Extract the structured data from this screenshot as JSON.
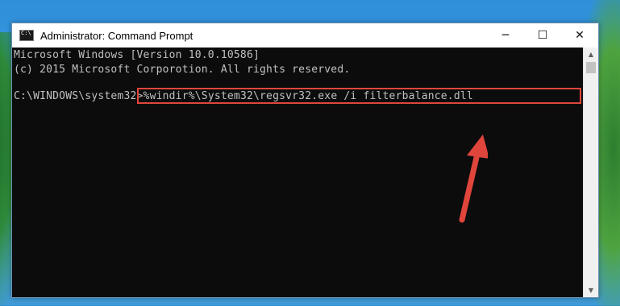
{
  "window": {
    "title": "Administrator: Command Prompt",
    "controls": {
      "minimize": "─",
      "maximize": "☐",
      "close": "✕"
    }
  },
  "console": {
    "lines": [
      "Microsoft Windows [Version 10.0.10586]",
      "(c) 2015 Microsoft Corporotion. All rights reserved.",
      ""
    ],
    "prompt": "C:\\WINDOWS\\system32>",
    "command": "%windir%\\System32\\regsvr32.exe /i filterbalance.dll"
  },
  "scrollbar": {
    "up": "▲",
    "down": "▼"
  },
  "colors": {
    "console_bg": "#0c0c0c",
    "console_text": "#c0c0c0",
    "highlight": "#e0453c"
  }
}
